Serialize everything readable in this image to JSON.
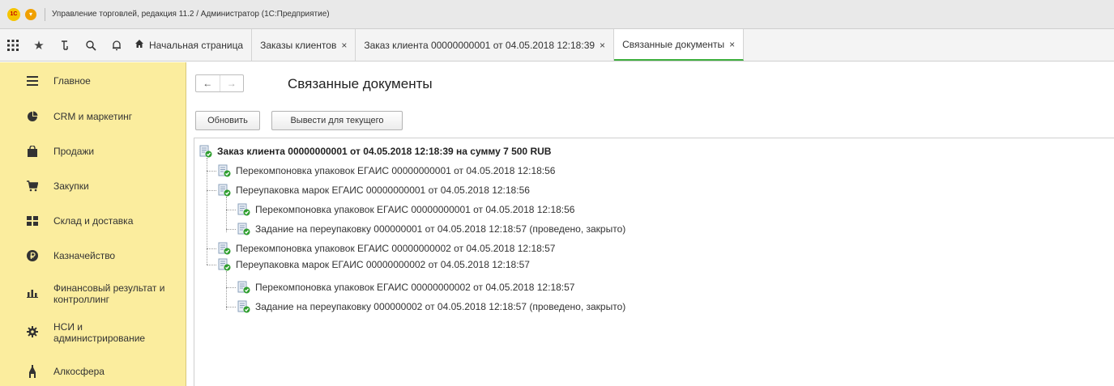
{
  "window": {
    "title": "Управление торговлей, редакция 11.2 / Администратор  (1С:Предприятие)",
    "logo_text": "1С"
  },
  "toolbar_icons": [
    "apps-grid-icon",
    "star-icon",
    "history-icon",
    "search-icon",
    "bell-icon"
  ],
  "tabs": {
    "home": {
      "label": "Начальная страница"
    },
    "items": [
      {
        "label": "Заказы клиентов",
        "close": "×"
      },
      {
        "label": "Заказ клиента 00000000001 от 04.05.2018 12:18:39",
        "close": "×"
      },
      {
        "label": "Связанные документы",
        "close": "×"
      }
    ]
  },
  "sidebar": {
    "items": [
      {
        "label": "Главное",
        "icon": "menu-lines-icon"
      },
      {
        "label": "CRM и маркетинг",
        "icon": "pie-chart-icon"
      },
      {
        "label": "Продажи",
        "icon": "shopping-bag-icon"
      },
      {
        "label": "Закупки",
        "icon": "cart-icon"
      },
      {
        "label": "Склад и доставка",
        "icon": "warehouse-icon"
      },
      {
        "label": "Казначейство",
        "icon": "ruble-coin-icon"
      },
      {
        "label": "Финансовый результат и",
        "label2": "контроллинг",
        "icon": "bar-chart-icon"
      },
      {
        "label": "НСИ и",
        "label2": "администрирование",
        "icon": "gear-icon"
      },
      {
        "label": "Алкосфера",
        "icon": "alco-icon"
      }
    ]
  },
  "form": {
    "title": "Связанные документы",
    "nav_back": "←",
    "nav_forward": "→",
    "refresh_button": "Обновить",
    "show_current_button": "Вывести для текущего"
  },
  "tree": {
    "root": "Заказ клиента 00000000001 от 04.05.2018 12:18:39 на сумму 7 500 RUB",
    "nodes": [
      "Перекомпоновка упаковок ЕГАИС 00000000001 от 04.05.2018 12:18:56",
      "Переупаковка марок ЕГАИС 00000000001 от 04.05.2018 12:18:56",
      "Перекомпоновка упаковок ЕГАИС 00000000001 от 04.05.2018 12:18:56",
      "Задание на переупаковку 000000001 от 04.05.2018 12:18:57 (проведено, закрыто)",
      "Перекомпоновка упаковок ЕГАИС 00000000002 от 04.05.2018 12:18:57",
      "Переупаковка марок ЕГАИС 00000000002 от 04.05.2018 12:18:57",
      "Перекомпоновка упаковок ЕГАИС 00000000002 от 04.05.2018 12:18:57",
      "Задание на переупаковку 000000002 от 04.05.2018 12:18:57 (проведено, закрыто)"
    ]
  },
  "colors": {
    "sidebar_bg": "#fbed9e",
    "active_tab_underline": "#3daf3d",
    "doc_check": "#2e9e2e"
  }
}
